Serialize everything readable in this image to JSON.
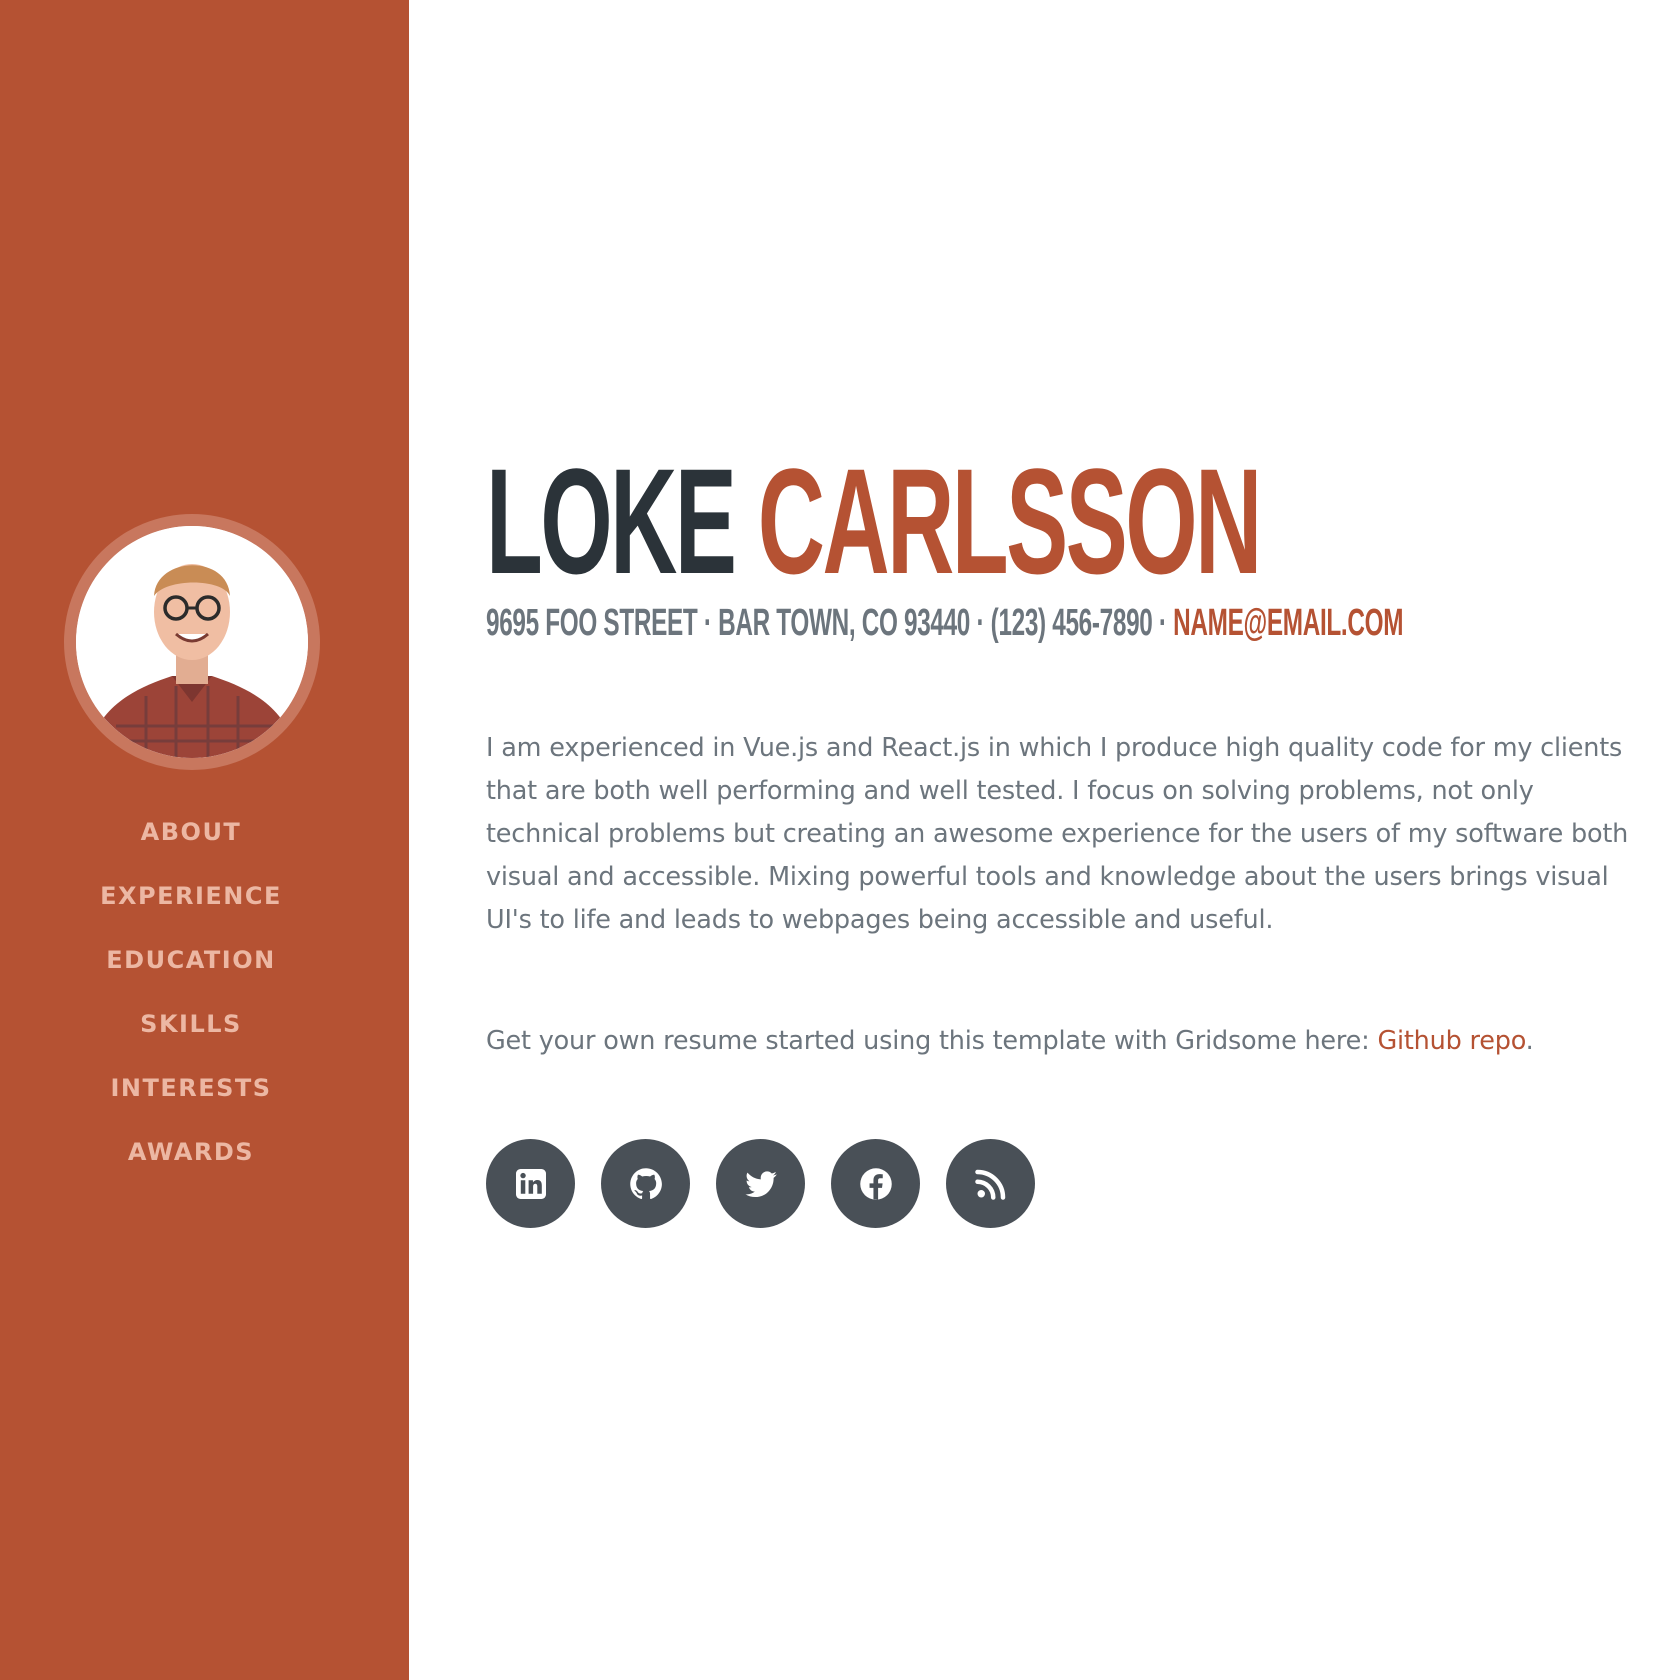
{
  "profile": {
    "first_name": "LOKE",
    "last_name": "CARLSSON",
    "contact_prefix": "9695 FOO STREET · BAR TOWN, CO 93440 · (123) 456-7890 · ",
    "email": "NAME@EMAIL.COM",
    "bio": "I am experienced in Vue.js and React.js in which I produce high quality code for my clients that are both well performing and well tested. I focus on solving problems, not only technical problems but creating an awesome experience for the users of my software both visual and accessible. Mixing powerful tools and knowledge about the users brings visual UI's to life and leads to webpages being accessible and useful.",
    "cta_text": "Get your own resume started using this template with Gridsome here: ",
    "cta_link": "Github repo",
    "cta_suffix": "."
  },
  "nav": {
    "items": [
      {
        "label": "ABOUT"
      },
      {
        "label": "EXPERIENCE"
      },
      {
        "label": "EDUCATION"
      },
      {
        "label": "SKILLS"
      },
      {
        "label": "INTERESTS"
      },
      {
        "label": "AWARDS"
      }
    ]
  },
  "social": [
    {
      "icon": "linkedin-icon"
    },
    {
      "icon": "github-icon"
    },
    {
      "icon": "twitter-icon"
    },
    {
      "icon": "facebook-icon"
    },
    {
      "icon": "rss-icon"
    }
  ],
  "colors": {
    "accent": "#b55233",
    "dark": "#2b3339",
    "text": "#6c757d",
    "icon_bg": "#495057",
    "nav_text": "#ecb7a3"
  }
}
